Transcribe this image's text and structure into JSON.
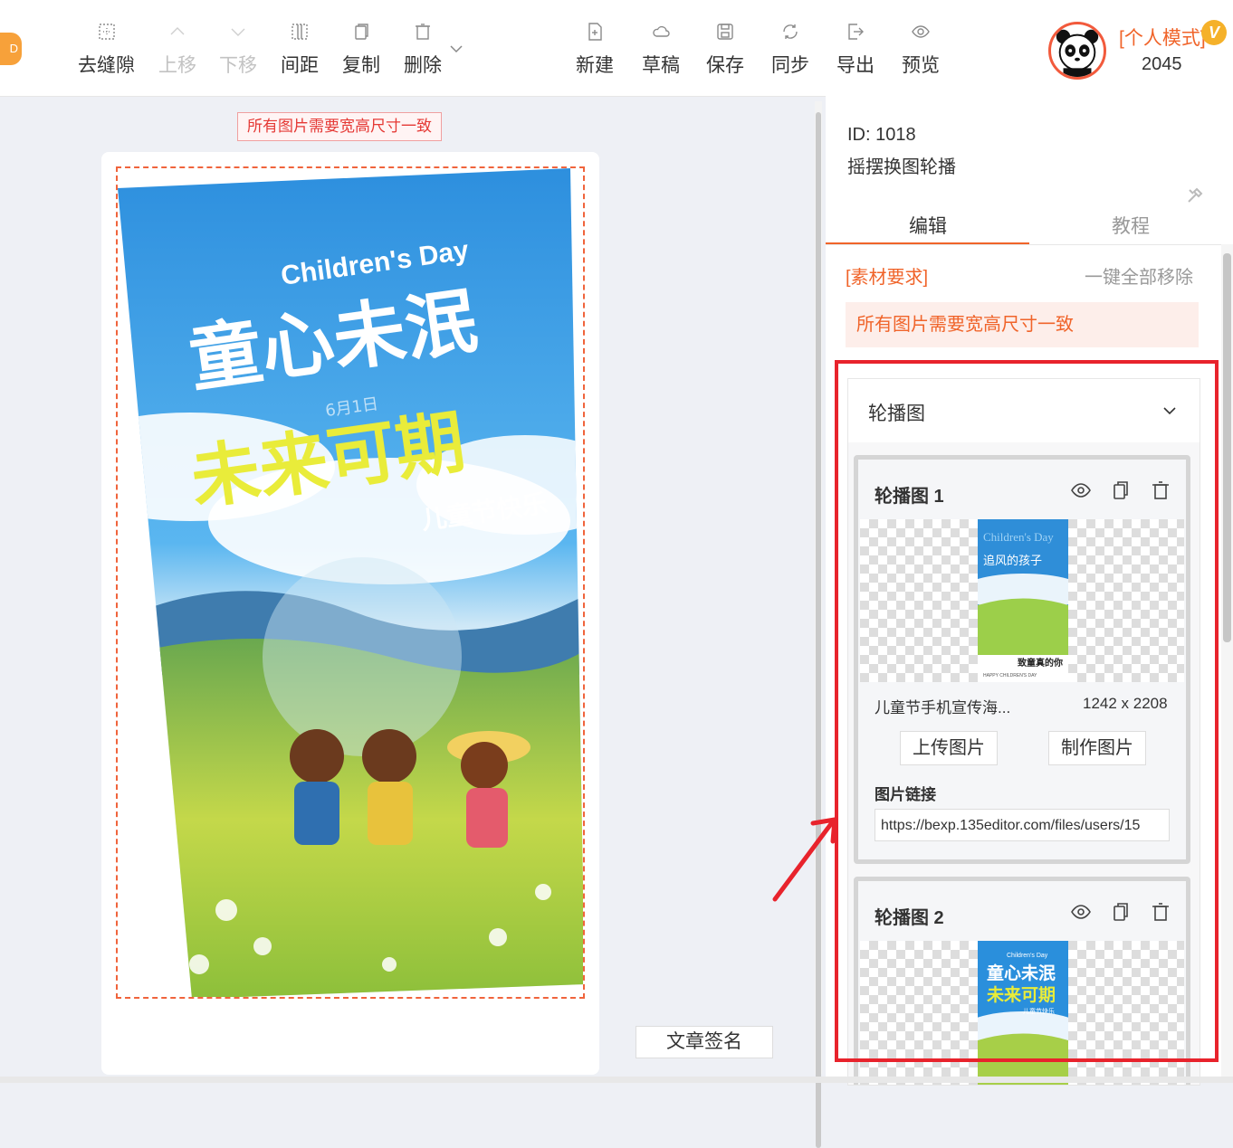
{
  "toolbar": {
    "remove_gap": "去缝隙",
    "move_up": "上移",
    "move_down": "下移",
    "spacing": "间距",
    "copy": "复制",
    "delete": "删除",
    "new": "新建",
    "draft": "草稿",
    "save": "保存",
    "sync": "同步",
    "export": "导出",
    "preview": "预览"
  },
  "user": {
    "mode": "[个人模式]",
    "badge": "V",
    "number": "2045"
  },
  "canvas": {
    "tip": "所有图片需要宽高尺寸一致",
    "sign_button": "文章签名",
    "poster": {
      "en_title": "Children's Day",
      "line1": "童心未泯",
      "line2": "未来可期",
      "date": "6月1日",
      "subtitle": "儿童节快乐"
    }
  },
  "panel": {
    "id": "ID: 1018",
    "name": "摇摆换图轮播",
    "tabs": [
      {
        "label": "编辑",
        "active": true
      },
      {
        "label": "教程",
        "active": false
      }
    ],
    "requirement_label": "[素材要求]",
    "remove_all": "一键全部移除",
    "notice": "所有图片需要宽高尺寸一致",
    "carousel_title": "轮播图",
    "slides": [
      {
        "title": "轮播图 1",
        "file_name": "儿童节手机宣传海...",
        "file_size": "1242 x 2208",
        "upload_btn": "上传图片",
        "make_btn": "制作图片",
        "link_label": "图片链接",
        "link_value": "https://bexp.135editor.com/files/users/15",
        "thumb_text": {
          "en": "Children's Day",
          "cn1": "追风的孩子",
          "cn2": "致童真的你",
          "tag": "HAPPY CHILDREN'S DAY"
        }
      },
      {
        "title": "轮播图 2",
        "thumb_text": {
          "en": "Children's Day",
          "cn1": "童心未泯",
          "cn2": "未来可期",
          "tag": "儿童节快乐"
        }
      }
    ]
  },
  "colors": {
    "accent": "#f0642a",
    "highlight_box": "#e8232c",
    "notice_bg": "#fdeeea"
  }
}
